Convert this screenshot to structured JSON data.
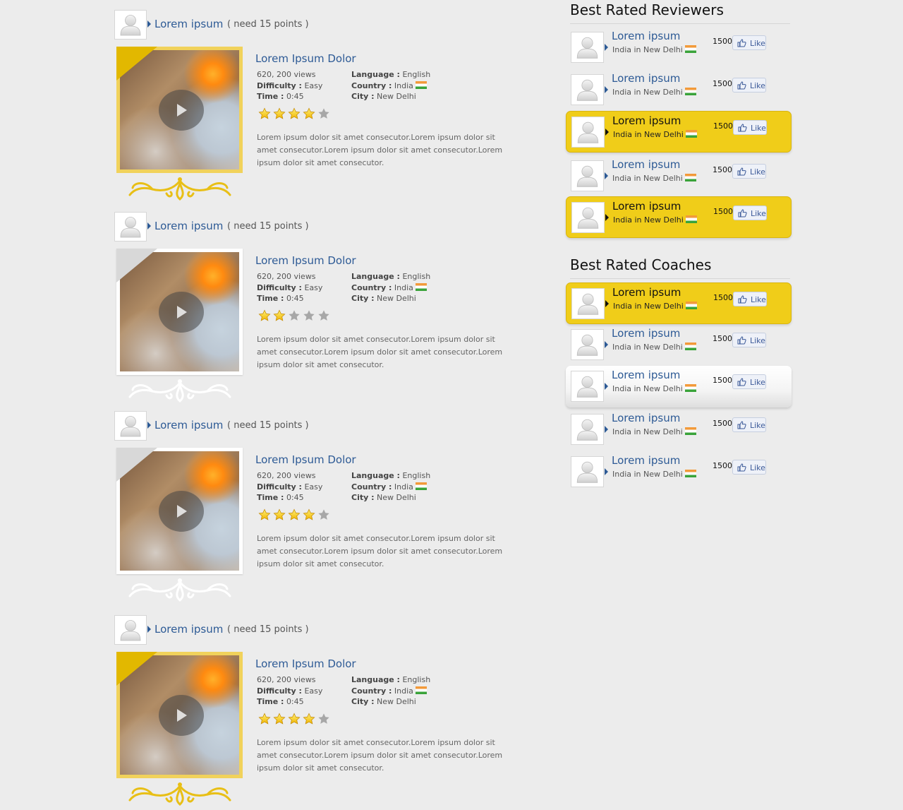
{
  "colors": {
    "accent": "#2d5a95",
    "gold": "#f0cd19",
    "silver": "#dddddd"
  },
  "videos": [
    {
      "author": "Lorem ipsum",
      "points": "( need 15 points )",
      "title": "Lorem Ipsum Dolor",
      "views": "620, 200 views",
      "difficulty_label": "Difficulty :",
      "difficulty": "Easy",
      "time_label": "Time :",
      "time": "0:45",
      "language_label": "Language :",
      "language": "English",
      "country_label": "Country :",
      "country": "India",
      "city_label": "City :",
      "city": "New Delhi",
      "rating": 4,
      "frame": "gold",
      "description": "Lorem ipsum dolor sit amet consecutor.Lorem ipsum dolor sit amet consecutor.Lorem ipsum dolor sit amet consecutor.Lorem ipsum dolor sit amet consecutor."
    },
    {
      "author": "Lorem ipsum",
      "points": "( need 15 points )",
      "title": "Lorem Ipsum Dolor",
      "views": "620, 200 views",
      "difficulty_label": "Difficulty :",
      "difficulty": "Easy",
      "time_label": "Time :",
      "time": "0:45",
      "language_label": "Language :",
      "language": "English",
      "country_label": "Country :",
      "country": "India",
      "city_label": "City :",
      "city": "New Delhi",
      "rating": 2,
      "frame": "silver",
      "description": "Lorem ipsum dolor sit amet consecutor.Lorem ipsum dolor sit amet consecutor.Lorem ipsum dolor sit amet consecutor.Lorem ipsum dolor sit amet consecutor."
    },
    {
      "author": "Lorem ipsum",
      "points": "( need 15 points )",
      "title": "Lorem Ipsum Dolor",
      "views": "620, 200 views",
      "difficulty_label": "Difficulty :",
      "difficulty": "Easy",
      "time_label": "Time :",
      "time": "0:45",
      "language_label": "Language :",
      "language": "English",
      "country_label": "Country :",
      "country": "India",
      "city_label": "City :",
      "city": "New Delhi",
      "rating": 4,
      "frame": "silver",
      "description": "Lorem ipsum dolor sit amet consecutor.Lorem ipsum dolor sit amet consecutor.Lorem ipsum dolor sit amet consecutor.Lorem ipsum dolor sit amet consecutor."
    },
    {
      "author": "Lorem ipsum",
      "points": "( need 15 points )",
      "title": "Lorem Ipsum Dolor",
      "views": "620, 200 views",
      "difficulty_label": "Difficulty :",
      "difficulty": "Easy",
      "time_label": "Time :",
      "time": "0:45",
      "language_label": "Language :",
      "language": "English",
      "country_label": "Country :",
      "country": "India",
      "city_label": "City :",
      "city": "New Delhi",
      "rating": 4,
      "frame": "gold",
      "description": "Lorem ipsum dolor sit amet consecutor.Lorem ipsum dolor sit amet consecutor.Lorem ipsum dolor sit amet consecutor.Lorem ipsum dolor sit amet consecutor."
    }
  ],
  "reviewers": {
    "title": "Best Rated Reviewers",
    "items": [
      {
        "name": "Lorem ipsum",
        "location": "India in New Delhi",
        "count": "1500",
        "like": "Like",
        "style": "plain"
      },
      {
        "name": "Lorem ipsum",
        "location": "India in New Delhi",
        "count": "1500",
        "like": "Like",
        "style": "plain"
      },
      {
        "name": "Lorem ipsum",
        "location": "India in New Delhi",
        "count": "1500",
        "like": "Like",
        "style": "yellow"
      },
      {
        "name": "Lorem ipsum",
        "location": "India in New Delhi",
        "count": "1500",
        "like": "Like",
        "style": "plain"
      },
      {
        "name": "Lorem ipsum",
        "location": "India in New Delhi",
        "count": "1500",
        "like": "Like",
        "style": "yellow"
      }
    ]
  },
  "coaches": {
    "title": "Best Rated Coaches",
    "items": [
      {
        "name": "Lorem ipsum",
        "location": "India in New Delhi",
        "count": "1500",
        "like": "Like",
        "style": "yellow"
      },
      {
        "name": "Lorem ipsum",
        "location": "India in New Delhi",
        "count": "1500",
        "like": "Like",
        "style": "plain"
      },
      {
        "name": "Lorem ipsum",
        "location": "India in New Delhi",
        "count": "1500",
        "like": "Like",
        "style": "white"
      },
      {
        "name": "Lorem ipsum",
        "location": "India in New Delhi",
        "count": "1500",
        "like": "Like",
        "style": "plain"
      },
      {
        "name": "Lorem ipsum",
        "location": "India in New Delhi",
        "count": "1500",
        "like": "Like",
        "style": "plain"
      }
    ]
  }
}
